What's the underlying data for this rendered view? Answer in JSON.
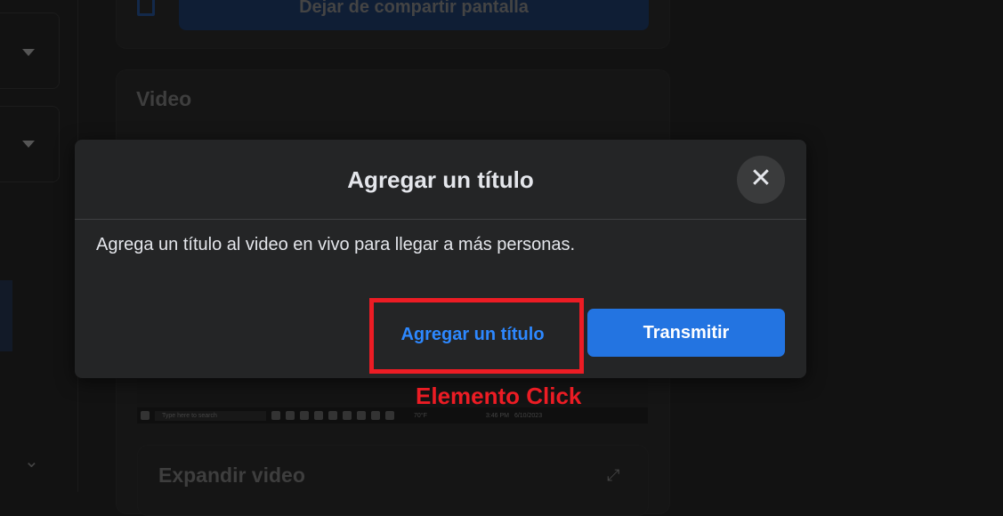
{
  "background": {
    "share_button_label": "Dejar de compartir pantalla",
    "video_section_title": "Video",
    "expand_video_title": "Expandir video",
    "taskbar": {
      "search_placeholder": "Type here to search",
      "weather": "70°F",
      "time": "3:46 PM",
      "date": "6/10/2023"
    }
  },
  "modal": {
    "title": "Agregar un título",
    "body": "Agrega un título al video en vivo para llegar a más personas.",
    "secondary_button": "Agregar un título",
    "primary_button": "Transmitir",
    "close_icon": "close-icon"
  },
  "annotation": {
    "label": "Elemento Click",
    "color": "#ec1c24"
  },
  "colors": {
    "primary": "#2374e1",
    "link": "#2d88ff",
    "modal_bg": "#242526"
  }
}
